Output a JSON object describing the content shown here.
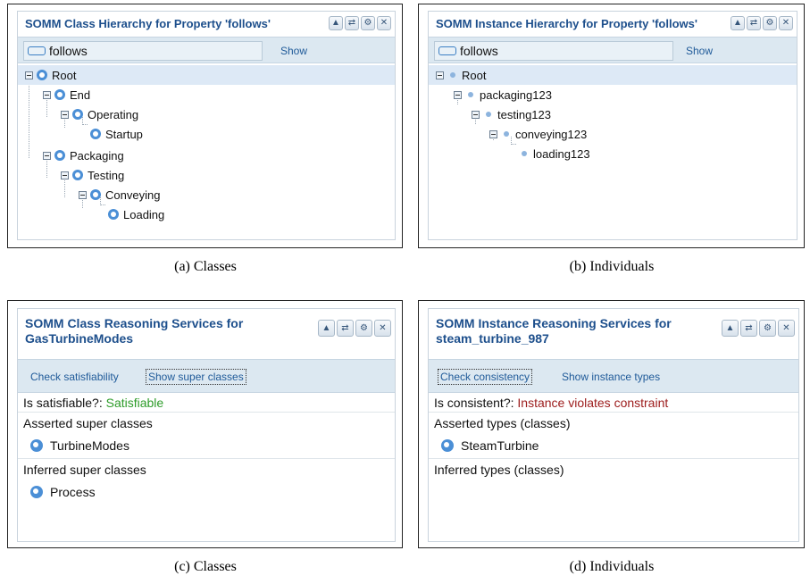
{
  "panels": {
    "a": {
      "title": "SOMM Class Hierarchy for Property 'follows'",
      "search_value": "follows",
      "show_label": "Show",
      "tree": [
        "Root",
        "End",
        "Operating",
        "Startup",
        "Packaging",
        "Testing",
        "Conveying",
        "Loading"
      ],
      "caption": "(a) Classes"
    },
    "b": {
      "title": "SOMM Instance Hierarchy for Property 'follows'",
      "search_value": "follows",
      "show_label": "Show",
      "tree": [
        "Root",
        "packaging123",
        "testing123",
        "conveying123",
        "loading123"
      ],
      "caption": "(b) Individuals"
    },
    "c": {
      "title_line1": "SOMM Class Reasoning Services for",
      "title_line2": "GasTurbineModes",
      "action1": "Check satisfiability",
      "action2": "Show super classes",
      "status_label": "Is satisfiable?:",
      "status_value": "Satisfiable",
      "section1": "Asserted super classes",
      "section1_item": "TurbineModes",
      "section2": "Inferred super classes",
      "section2_item": "Process",
      "caption": "(c) Classes"
    },
    "d": {
      "title_line1": "SOMM Instance Reasoning Services for",
      "title_line2": "steam_turbine_987",
      "action1": "Check consistency",
      "action2": "Show instance types",
      "status_label": "Is consistent?:",
      "status_value": "Instance violates constraint",
      "section1": "Asserted types (classes)",
      "section1_item": "SteamTurbine",
      "section2": "Inferred types (classes)",
      "caption": "(d) Individuals"
    }
  },
  "toolbar_icons": [
    "collapse-icon",
    "refresh-icon",
    "settings-icon",
    "close-icon"
  ],
  "colors": {
    "title": "#1d4f8c",
    "bar": "#dce8f1",
    "satisfiable": "#2e9c2a",
    "violation": "#9c1b1b",
    "class_icon": "#4b8fd6"
  }
}
